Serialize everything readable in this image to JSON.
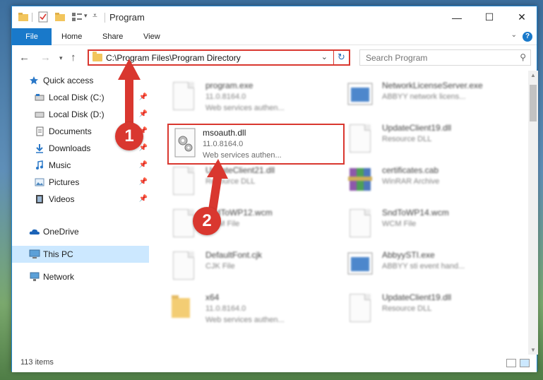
{
  "window": {
    "title": "Program",
    "controls": {
      "minimize": "—",
      "maximize": "☐",
      "close": "✕"
    }
  },
  "ribbon": {
    "tabs": [
      "File",
      "Home",
      "Share",
      "View"
    ],
    "help": "?"
  },
  "navigation": {
    "address_path": "C:\\Program Files\\Program Directory",
    "search_placeholder": "Search Program"
  },
  "sidebar": {
    "items": [
      {
        "label": "Quick access",
        "icon": "star-icon",
        "pinned": false
      },
      {
        "label": "Local Disk (C:)",
        "icon": "drive-icon",
        "pinned": true
      },
      {
        "label": "Local Disk (D:)",
        "icon": "drive-icon",
        "pinned": true
      },
      {
        "label": "Documents",
        "icon": "documents-icon",
        "pinned": true
      },
      {
        "label": "Downloads",
        "icon": "download-icon",
        "pinned": true
      },
      {
        "label": "Music",
        "icon": "music-icon",
        "pinned": true
      },
      {
        "label": "Pictures",
        "icon": "pictures-icon",
        "pinned": true
      },
      {
        "label": "Videos",
        "icon": "videos-icon",
        "pinned": true
      },
      {
        "label": "OneDrive",
        "icon": "cloud-icon",
        "pinned": false
      },
      {
        "label": "This PC",
        "icon": "computer-icon",
        "pinned": false,
        "selected": true
      },
      {
        "label": "Network",
        "icon": "network-icon",
        "pinned": false
      }
    ]
  },
  "files": {
    "highlighted": {
      "name": "msoauth.dll",
      "version": "11.0.8164.0",
      "description": "Web services authen..."
    },
    "left_column": [
      {
        "name": "program.exe",
        "line2": "11.0.8164.0",
        "line3": "Web services authen...",
        "icon": "exe-icon"
      },
      {
        "name": "UpdateClient21.dll",
        "line2": "Resource DLL",
        "line3": "",
        "icon": "dll-icon"
      },
      {
        "name": "SndToWP12.wcm",
        "line2": "WCM File",
        "line3": "",
        "icon": "file-icon"
      },
      {
        "name": "DefaultFont.cjk",
        "line2": "CJK File",
        "line3": "",
        "icon": "file-icon"
      },
      {
        "name": "x64",
        "line2": "11.0.8164.0",
        "line3": "Web services authen...",
        "icon": "folder-icon"
      }
    ],
    "right_column": [
      {
        "name": "NetworkLicenseServer.exe",
        "line2": "ABBYY network licens...",
        "line3": "",
        "icon": "exe-icon"
      },
      {
        "name": "UpdateClient19.dll",
        "line2": "Resource DLL",
        "line3": "",
        "icon": "dll-icon"
      },
      {
        "name": "certificates.cab",
        "line2": "WinRAR Archive",
        "line3": "",
        "icon": "archive-icon"
      },
      {
        "name": "SndToWP14.wcm",
        "line2": "WCM File",
        "line3": "",
        "icon": "file-icon"
      },
      {
        "name": "AbbyySTI.exe",
        "line2": "ABBYY sti event hand...",
        "line3": "",
        "icon": "exe-icon"
      },
      {
        "name": "UpdateClient19.dll",
        "line2": "Resource DLL",
        "line3": "",
        "icon": "dll-icon"
      }
    ]
  },
  "status": {
    "item_count": "113 items"
  },
  "callouts": [
    "1",
    "2"
  ],
  "colors": {
    "accent": "#1979ca",
    "highlight": "#d9372f",
    "selected": "#cce8ff"
  }
}
